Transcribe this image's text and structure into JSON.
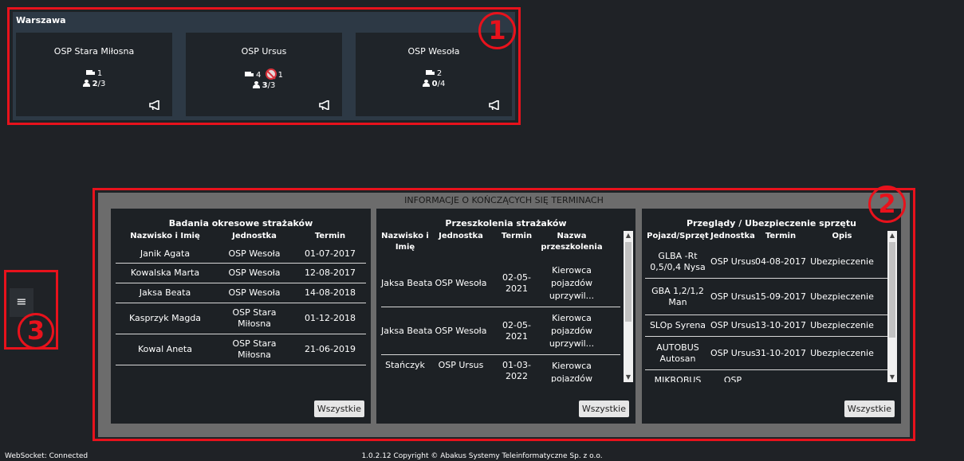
{
  "city": {
    "name": "Warszawa",
    "units": [
      {
        "name": "OSP Stara Miłosna",
        "trucks": "1",
        "banned": "",
        "people_ready": "2",
        "people_total": "/3"
      },
      {
        "name": "OSP Ursus",
        "trucks": "4",
        "banned": "1",
        "people_ready": "3",
        "people_total": "/3"
      },
      {
        "name": "OSP Wesoła",
        "trucks": "2",
        "banned": "",
        "people_ready": "0",
        "people_total": "/4"
      }
    ]
  },
  "callouts": {
    "one": "1",
    "two": "2",
    "three": "3"
  },
  "info": {
    "title": "INFORMACJE O KOŃCZĄCYCH SIĘ TERMINACH",
    "all_button": "Wszystkie",
    "exams": {
      "title": "Badania okresowe strażaków",
      "headers": [
        "Nazwisko i Imię",
        "Jednostka",
        "Termin"
      ],
      "rows": [
        [
          "Janik Agata",
          "OSP Wesoła",
          "01-07-2017"
        ],
        [
          "Kowalska Marta",
          "OSP Wesoła",
          "12-08-2017"
        ],
        [
          "Jaksa Beata",
          "OSP Wesoła",
          "14-08-2018"
        ],
        [
          "Kasprzyk Magda",
          "OSP Stara Miłosna",
          "01-12-2018"
        ],
        [
          "Kowal Aneta",
          "OSP Stara Miłosna",
          "21-06-2019"
        ]
      ]
    },
    "trainings": {
      "title": "Przeszkolenia strażaków",
      "headers": [
        "Nazwisko i Imię",
        "Jednostka",
        "Termin",
        "Nazwa przeszkolenia"
      ],
      "rows": [
        [
          "Jaksa Beata",
          "OSP Wesoła",
          "02-05-2021",
          "Kierowca pojazdów uprzywil..."
        ],
        [
          "Jaksa Beata",
          "OSP Wesoła",
          "02-05-2021",
          "Kierowca pojazdów uprzywil..."
        ],
        [
          "Stańczyk",
          "OSP Ursus",
          "01-03-2022",
          "Kierowca pojazdów"
        ]
      ]
    },
    "inspections": {
      "title": "Przeglądy / Ubezpieczenie sprzętu",
      "headers": [
        "Pojazd/Sprzęt",
        "Jednostka",
        "Termin",
        "Opis"
      ],
      "rows": [
        [
          "GLBA -Rt 0,5/0,4 Nysa",
          "OSP Ursus",
          "04-08-2017",
          "Ubezpieczenie"
        ],
        [
          "GBA 1,2/1,2 Man",
          "OSP Ursus",
          "15-09-2017",
          "Ubezpieczenie"
        ],
        [
          "SLOp Syrena",
          "OSP Ursus",
          "13-10-2017",
          "Ubezpieczenie"
        ],
        [
          "AUTOBUS Autosan",
          "OSP Ursus",
          "31-10-2017",
          "Ubezpieczenie"
        ],
        [
          "MIKROBUS",
          "OSP Ursus",
          "",
          ""
        ]
      ]
    }
  },
  "menu": {
    "icon_glyph": "≡"
  },
  "footer": {
    "status": "WebSocket: Connected",
    "copyright": "1.0.2.12 Copyright © Abakus Systemy Teleinformatyczne Sp. z o.o."
  }
}
